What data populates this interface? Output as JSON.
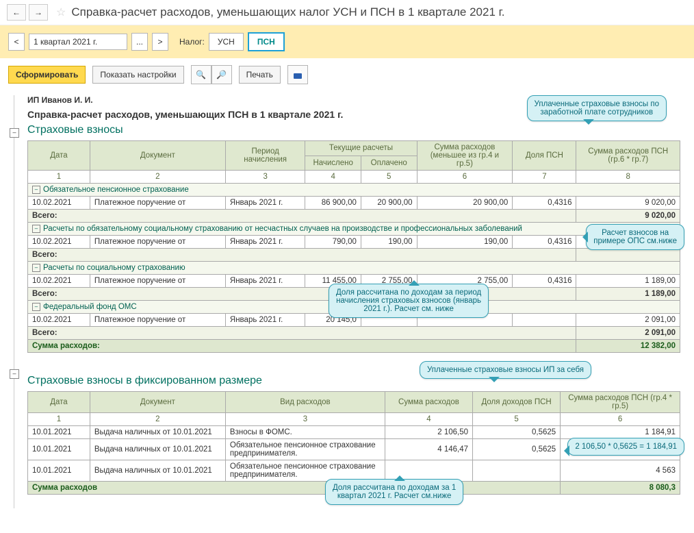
{
  "nav": {
    "back": "←",
    "fwd": "→"
  },
  "header": {
    "title": "Справка-расчет расходов, уменьшающих налог УСН и ПСН в 1 квартале 2021 г."
  },
  "periodbar": {
    "period": "1 квартал 2021 г.",
    "tax_label": "Налог:",
    "tab_usn": "УСН",
    "tab_psn": "ПСН"
  },
  "toolbar": {
    "generate": "Сформировать",
    "settings": "Показать настройки",
    "print": "Печать"
  },
  "report": {
    "owner": "ИП Иванов И. И.",
    "title": "Справка-расчет расходов, уменьшающих ПСН в 1 квартале 2021 г.",
    "section1": {
      "heading": "Страховые взносы",
      "head": {
        "c1": "Дата",
        "c2": "Документ",
        "c3": "Период начисления",
        "c4g": "Текущие расчеты",
        "c4": "Начислено",
        "c5": "Оплачено",
        "c6": "Сумма расходов (меньшее из гр.4 и гр.5)",
        "c7": "Доля ПСН",
        "c8": "Сумма расходов ПСН (гр.6 * гр.7)"
      },
      "nums": {
        "c1": "1",
        "c2": "2",
        "c3": "3",
        "c4": "4",
        "c5": "5",
        "c6": "6",
        "c7": "7",
        "c8": "8"
      },
      "g1": {
        "name": "Обязательное пенсионное страхование",
        "date": "10.02.2021",
        "doc": "Платежное поручение от",
        "period": "Январь 2021 г.",
        "acc": "86 900,00",
        "paid": "20 900,00",
        "sum": "20 900,00",
        "share": "0,4316",
        "psn": "9 020,00",
        "total": "9 020,00"
      },
      "g2": {
        "name": "Расчеты по обязательному социальному страхованию от несчастных случаев на производстве и профессиональных заболеваний",
        "date": "10.02.2021",
        "doc": "Платежное поручение от",
        "period": "Январь 2021 г.",
        "acc": "790,00",
        "paid": "190,00",
        "sum": "190,00",
        "share": "0,4316",
        "psn": "",
        "total": ""
      },
      "g3": {
        "name": "Расчеты по социальному страхованию",
        "date": "10.02.2021",
        "doc": "Платежное поручение от",
        "period": "Январь 2021 г.",
        "acc": "11 455,00",
        "paid": "2 755,00",
        "sum": "2 755,00",
        "share": "0,4316",
        "psn": "1 189,00",
        "total": "1 189,00"
      },
      "g4": {
        "name": "Федеральный фонд ОМС",
        "date": "10.02.2021",
        "doc": "Платежное поручение от",
        "period": "Январь 2021 г.",
        "acc": "20 145,0",
        "paid": "",
        "sum": "",
        "share": "",
        "psn": "2 091,00",
        "total": "2 091,00"
      },
      "total_label": "Всего:",
      "grand_label": "Сумма расходов:",
      "grand": "12 382,00"
    },
    "section2": {
      "heading": "Страховые взносы в фиксированном размере",
      "head": {
        "c1": "Дата",
        "c2": "Документ",
        "c3": "Вид расходов",
        "c4": "Сумма расходов",
        "c5": "Доля доходов ПСН",
        "c6": "Сумма расходов ПСН (гр.4 * гр.5)"
      },
      "nums": {
        "c1": "1",
        "c2": "2",
        "c3": "3",
        "c4": "4",
        "c5": "5",
        "c6": "6"
      },
      "r1": {
        "date": "10.01.2021",
        "doc": "Выдача наличных  от 10.01.2021",
        "kind": "Взносы в ФОМС.",
        "sum": "2 106,50",
        "share": "0,5625",
        "psn": "1 184,91"
      },
      "r2": {
        "date": "10.01.2021",
        "doc": "Выдача наличных  от 10.01.2021",
        "kind": "Обязательное пенсионное страхование предпринимателя.",
        "sum": "4 146,47",
        "share": "0,5625",
        "psn": ""
      },
      "r3": {
        "date": "10.01.2021",
        "doc": "Выдача наличных  от 10.01.2021",
        "kind": "Обязательное пенсионное страхование предпринимателя.",
        "sum": "",
        "share": "",
        "psn": "4 563"
      },
      "grand_label": "Сумма расходов",
      "grand": "8 080,3"
    }
  },
  "callouts": {
    "c1": "Уплаченные страховые взносы по\nзаработной плате сотрудников",
    "c2": "Расчет взносов на\nпримере ОПС см.ниже",
    "c3": "Доля рассчитана по доходам за период\nначисления страховых взносов (январь\n2021 г.). Расчет см. ниже",
    "c4": "Уплаченные страховые взносы ИП за себя",
    "c5": "2 106,50 * 0,5625 = 1 184,91",
    "c6": "Доля рассчитана по доходам за 1\nквартал 2021 г. Расчет см.ниже"
  }
}
